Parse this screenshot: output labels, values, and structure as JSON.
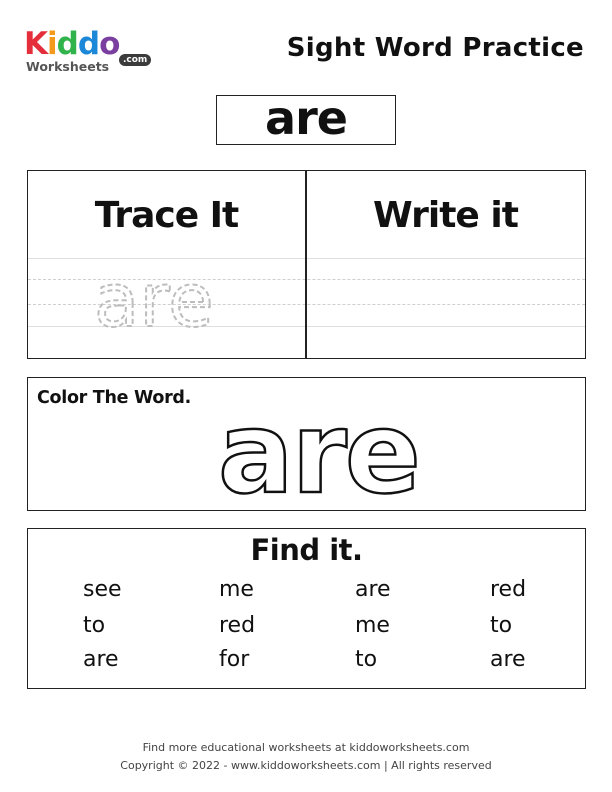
{
  "header": {
    "logo": {
      "main_text": "Kiddo",
      "sub_text": "Worksheets",
      "tld": ".com",
      "letter_colors": [
        "#e52e3c",
        "#f39a1e",
        "#2fb34a",
        "#1e88d8",
        "#7b3fa0"
      ]
    },
    "title": "Sight Word Practice"
  },
  "word": "are",
  "trace": {
    "trace_heading": "Trace It",
    "write_heading": "Write it",
    "trace_word": "are"
  },
  "color": {
    "label": "Color The Word.",
    "word": "are"
  },
  "find": {
    "heading": "Find it.",
    "rows": [
      [
        "see",
        "me",
        "are",
        "red"
      ],
      [
        "to",
        "red",
        "me",
        "to"
      ],
      [
        "are",
        "for",
        "to",
        "are"
      ]
    ]
  },
  "footer": {
    "line1": "Find more educational worksheets at kiddoworksheets.com",
    "line2": "Copyright © 2022 - www.kiddoworksheets.com  |  All rights reserved"
  }
}
